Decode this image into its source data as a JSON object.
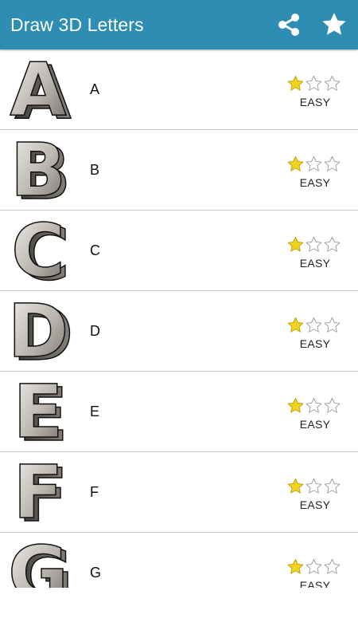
{
  "app": {
    "title": "Draw 3D Letters",
    "header_color": "#2d8db3",
    "icons": {
      "share": "share-icon",
      "favorite": "star-icon"
    }
  },
  "lessons": [
    {
      "letter": "A",
      "rating": 1,
      "max_rating": 3,
      "difficulty": "EASY"
    },
    {
      "letter": "B",
      "rating": 1,
      "max_rating": 3,
      "difficulty": "EASY"
    },
    {
      "letter": "C",
      "rating": 1,
      "max_rating": 3,
      "difficulty": "EASY"
    },
    {
      "letter": "D",
      "rating": 1,
      "max_rating": 3,
      "difficulty": "EASY"
    },
    {
      "letter": "E",
      "rating": 1,
      "max_rating": 3,
      "difficulty": "EASY"
    },
    {
      "letter": "F",
      "rating": 1,
      "max_rating": 3,
      "difficulty": "EASY"
    },
    {
      "letter": "G",
      "rating": 1,
      "max_rating": 3,
      "difficulty": "EASY"
    }
  ],
  "colors": {
    "star_filled": "#f2d21b",
    "star_outline": "#9a9a9a"
  }
}
